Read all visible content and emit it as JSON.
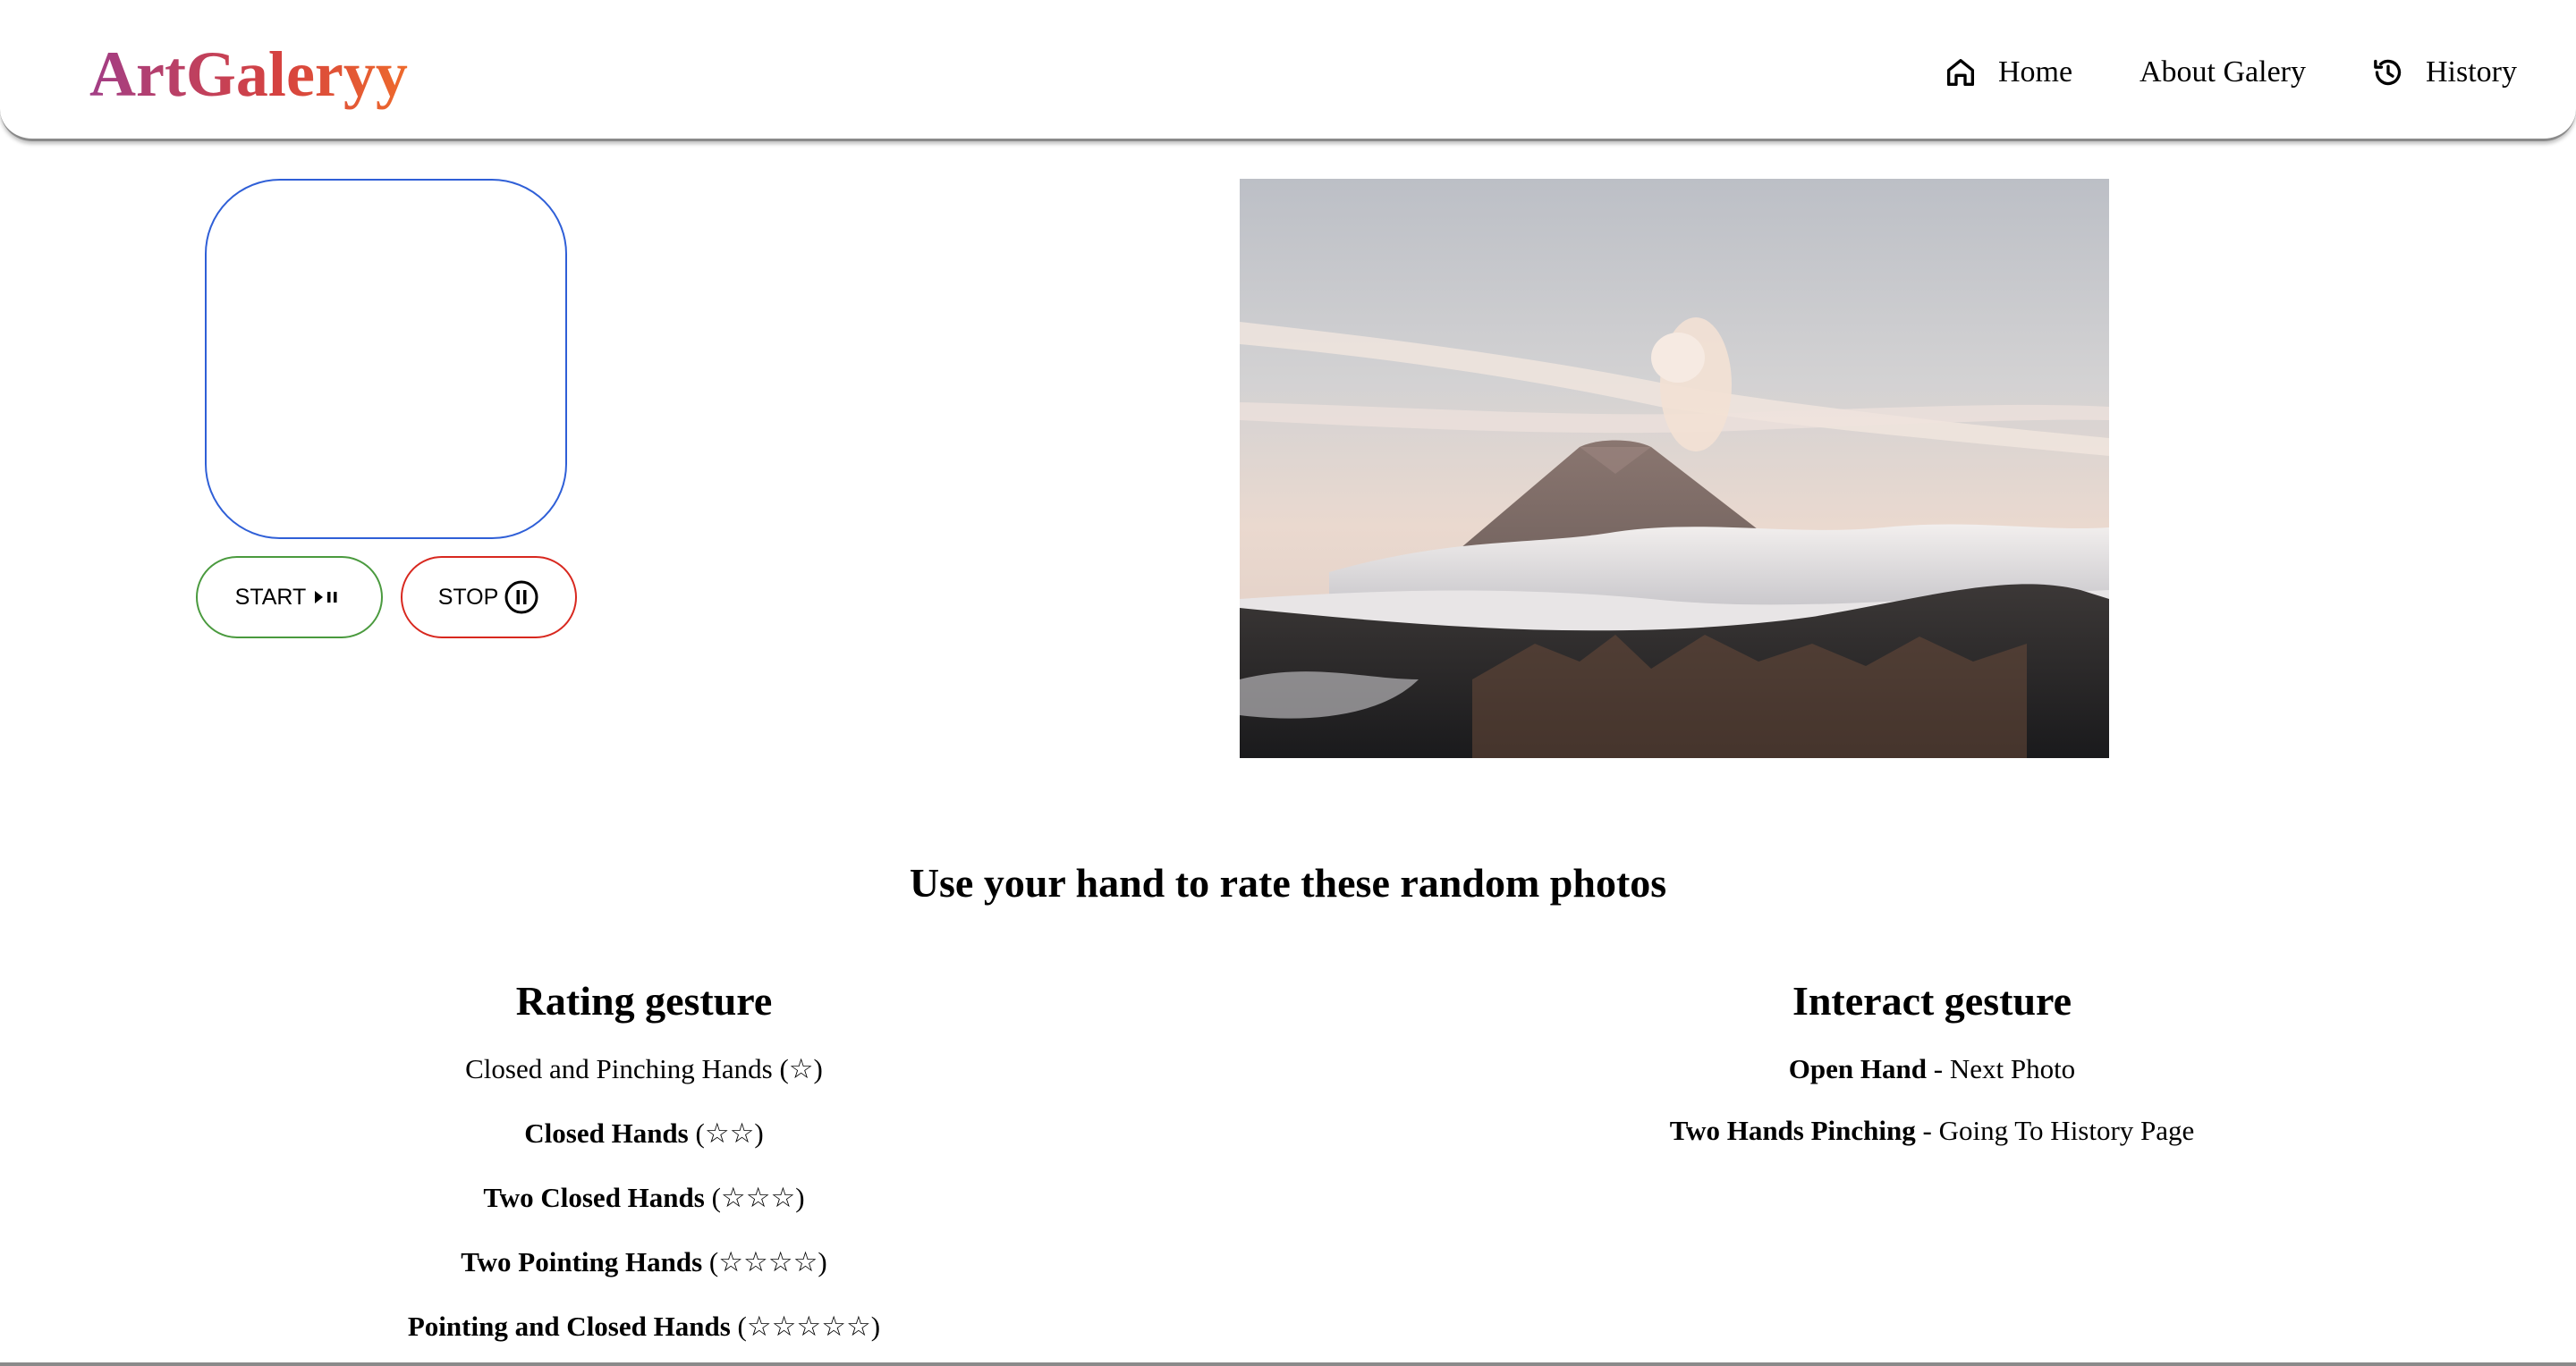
{
  "header": {
    "logo": "ArtGaleryy",
    "nav": {
      "home": "Home",
      "about": "About Galery",
      "history": "History"
    }
  },
  "controls": {
    "start_label": "START",
    "stop_label": "STOP"
  },
  "headline": "Use your hand to rate these random photos",
  "rating": {
    "title": "Rating gesture",
    "items": [
      {
        "name": "Closed and Pinching Hands",
        "stars": "(☆)"
      },
      {
        "name": "Closed Hands",
        "stars": "(☆☆)"
      },
      {
        "name": "Two Closed Hands",
        "stars": "(☆☆☆)"
      },
      {
        "name": "Two Pointing Hands",
        "stars": "(☆☆☆☆)"
      },
      {
        "name": "Pointing and Closed Hands",
        "stars": "(☆☆☆☆☆)"
      }
    ]
  },
  "interact": {
    "title": "Interact gesture",
    "items": [
      {
        "name": "Open Hand",
        "action": " - Next Photo"
      },
      {
        "name": "Two Hands Pinching",
        "action": " - Going To History Page"
      }
    ]
  },
  "colors": {
    "cam_border": "#2f5fd7",
    "start_border": "#4a9a3e",
    "stop_border": "#d8281f",
    "logo_gradient": [
      "#a23e86",
      "#d6423f",
      "#ee6a2c"
    ]
  },
  "icons": {
    "home": "home-icon",
    "history": "history-icon",
    "start": "play-pause-icon",
    "stop": "pause-circle-icon"
  }
}
